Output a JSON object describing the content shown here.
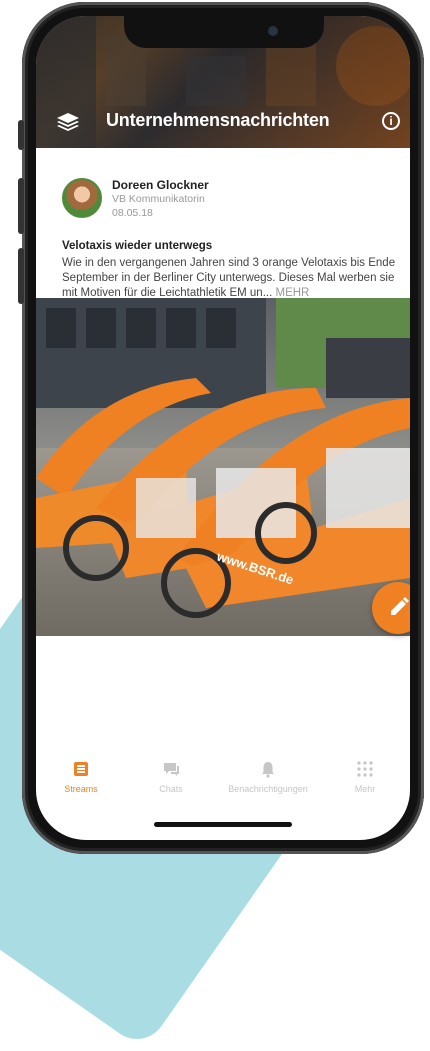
{
  "header": {
    "title": "Unternehmensnachrichten",
    "layers_icon": "layers-icon",
    "info_icon": "info-icon",
    "info_glyph": "i"
  },
  "post": {
    "author_name": "Doreen Glockner",
    "author_role": "VB Kommunikatorin",
    "date": "08.05.18",
    "title": "Velotaxis wieder unterwegs",
    "body": "Wie in den vergangenen Jahren sind 3 orange Velotaxis bis Ende September in der Berliner City unterwegs. Dieses Mal werben sie mit Motiven für die Leichtathletik EM un...",
    "more_label": "MEHR",
    "photo_text": "www.BSR.de"
  },
  "fab": {
    "icon": "pencil-icon"
  },
  "tabs": [
    {
      "label": "Streams",
      "icon": "streams-icon",
      "active": true
    },
    {
      "label": "Chats",
      "icon": "chat-icon",
      "active": false
    },
    {
      "label": "Benachrichtigungen",
      "icon": "bell-icon",
      "active": false
    },
    {
      "label": "Mehr",
      "icon": "grid-icon",
      "active": false
    }
  ],
  "colors": {
    "accent": "#f08122",
    "inactive": "#c6c6c6",
    "background_teal": "#a9dde3"
  }
}
